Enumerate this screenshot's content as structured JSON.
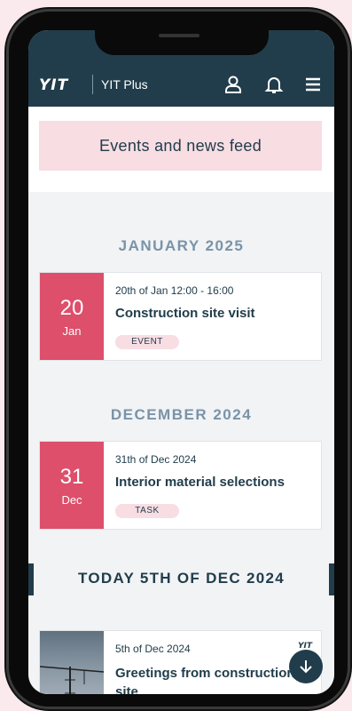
{
  "header": {
    "logo": "YIT",
    "app_name": "YIT Plus",
    "icons": [
      "user-icon",
      "bell-icon",
      "menu-icon"
    ]
  },
  "feed_title": "Events and news feed",
  "sections": [
    {
      "month": "JANUARY 2025",
      "card": {
        "day": "20",
        "mon": "Jan",
        "when": "20th of Jan 12:00 - 16:00",
        "title": "Construction site visit",
        "tag": "EVENT"
      }
    },
    {
      "month": "DECEMBER 2024",
      "card": {
        "day": "31",
        "mon": "Dec",
        "when": "31th of Dec 2024",
        "title": "Interior material selections",
        "tag": "TASK"
      }
    }
  ],
  "today": "TODAY 5TH OF DEC 2024",
  "news": {
    "when": "5th of Dec 2024",
    "title": "Greetings from construction site",
    "logo": "YIT"
  },
  "colors": {
    "primary": "#213d4b",
    "accent": "#dd4f6b",
    "pink": "#f8dde3",
    "month": "#7a93a7"
  }
}
